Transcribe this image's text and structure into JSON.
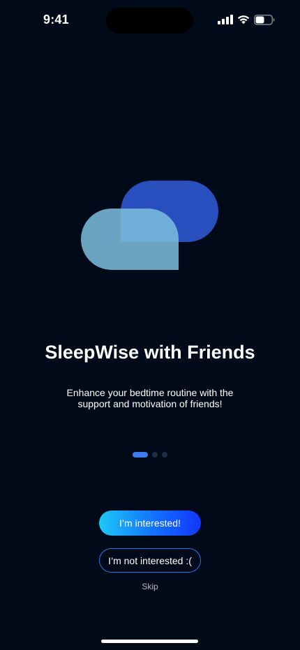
{
  "status_bar": {
    "time": "9:41",
    "icons": [
      "cellular-signal-icon",
      "wifi-icon",
      "battery-icon"
    ]
  },
  "onboarding": {
    "title": "SleepWise with Friends",
    "subtitle": "Enhance your bedtime routine with the support and motivation of friends!",
    "page_indicator": {
      "current": 1,
      "total": 3
    },
    "primary_button": "I’m interested!",
    "secondary_button": "I’m not interested :(",
    "skip_link": "Skip"
  },
  "colors": {
    "background": "#010A18",
    "accent": "#3E7BF0",
    "gradient_start": "#1CC8F7",
    "gradient_end": "#1338FF",
    "bubble_back": "#2B53C8",
    "bubble_front": "#7DBEDE"
  }
}
